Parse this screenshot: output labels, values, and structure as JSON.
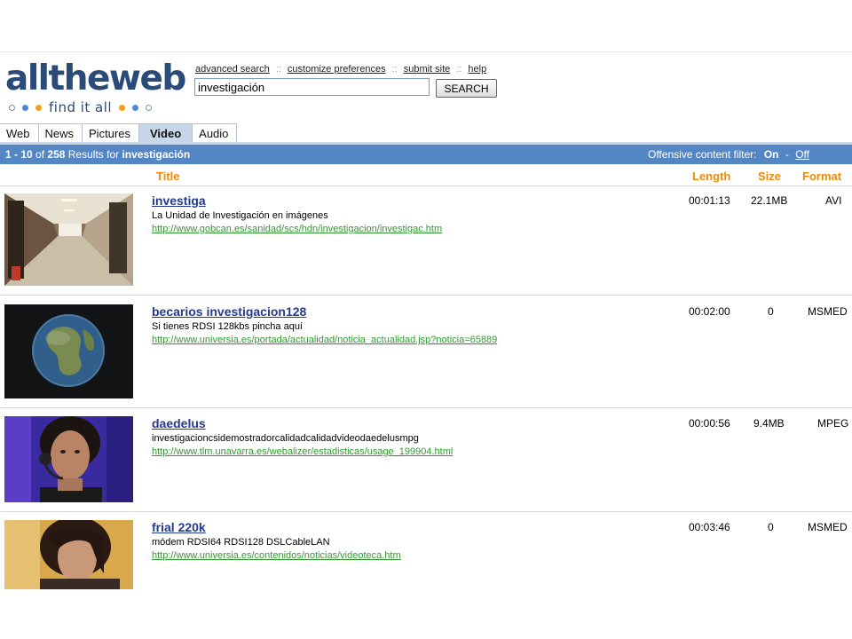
{
  "logo": {
    "word": "alltheweb",
    "tagline": "find it all"
  },
  "toplinks": [
    "advanced search",
    "customize preferences",
    "submit site",
    "help"
  ],
  "toplink_separator": "::",
  "search": {
    "value": "investigación",
    "button_label": "SEARCH"
  },
  "tabs": [
    {
      "label": "Web",
      "active": false
    },
    {
      "label": "News",
      "active": false
    },
    {
      "label": "Pictures",
      "active": false
    },
    {
      "label": "Video",
      "active": true
    },
    {
      "label": "Audio",
      "active": false
    }
  ],
  "results_bar": {
    "range": "1 - 10",
    "of_text": "of",
    "total": "258",
    "results_for_text": "Results for",
    "query": "investigación",
    "filter_label": "Offensive content filter:",
    "filter_on": "On",
    "filter_dash": "-",
    "filter_off": "Off"
  },
  "columns": {
    "title": "Title",
    "length": "Length",
    "size": "Size",
    "format": "Format"
  },
  "results": [
    {
      "title": "investiga",
      "description": "La Unidad de Investigación en imágenes",
      "url": "http://www.gobcan.es/sanidad/scs/hdn/investigacion/investigac.htm",
      "length": "00:01:13",
      "size": "22.1MB",
      "format": "AVI"
    },
    {
      "title": "becarios investigacion128",
      "description": "Si tienes RDSI 128kbs pincha aquí",
      "url": "http://www.universia.es/portada/actualidad/noticia_actualidad.jsp?noticia=65889",
      "length": "00:02:00",
      "size": "0",
      "format": "MSMED"
    },
    {
      "title": "daedelus",
      "description": "investigacioncsidemostradorcalidadcalidadvideodaedelusmpg",
      "url": "http://www.tlm.unavarra.es/webalizer/estadisticas/usage_199904.html",
      "length": "00:00:56",
      "size": "9.4MB",
      "format": "MPEG"
    },
    {
      "title": "frial 220k",
      "description": "módem RDSI64 RDSI128 DSLCableLAN",
      "url": "http://www.universia.es/contenidos/noticias/videoteca.htm",
      "length": "00:03:46",
      "size": "0",
      "format": "MSMED"
    }
  ],
  "colors": {
    "brand": "#2a4a78",
    "results_bar": "#5486c4",
    "tab_active": "#c8d6ea",
    "column_header": "#f08a00",
    "title_link": "#223a8f",
    "url": "#2e9a2e"
  },
  "thumbnails": [
    "hallway-thumbnail",
    "earth-globe-thumbnail",
    "woman-headset-thumbnail",
    "woman-portrait-thumbnail"
  ]
}
